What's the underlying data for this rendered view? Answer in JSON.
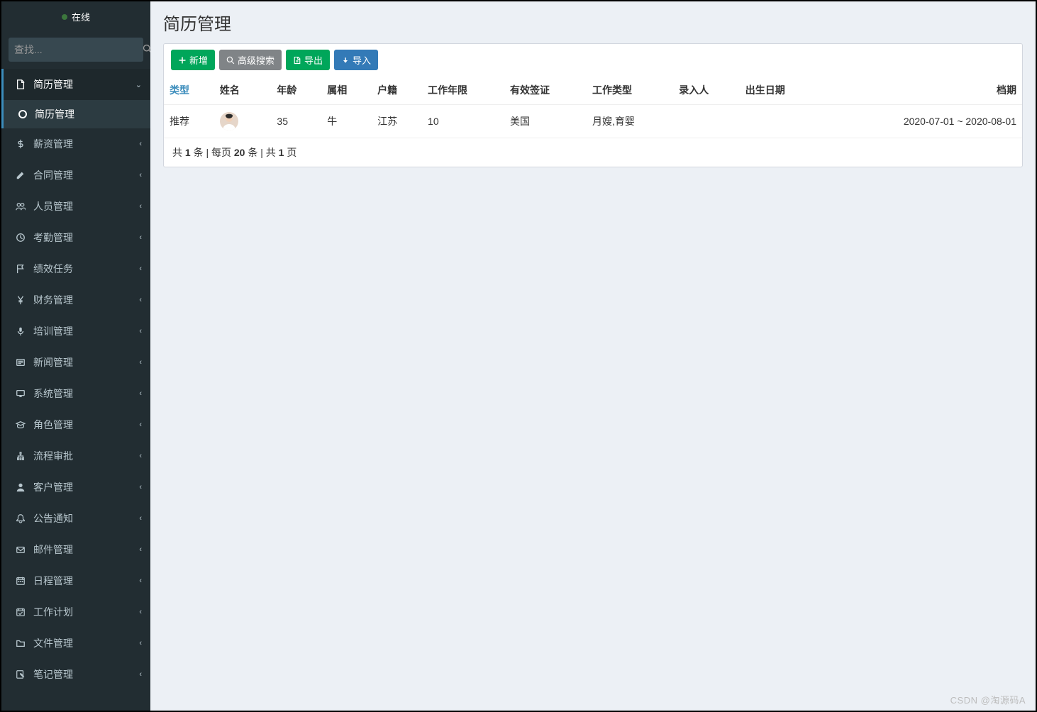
{
  "sidebar": {
    "status_label": "在线",
    "search_placeholder": "查找...",
    "items": [
      {
        "icon": "file",
        "label": "简历管理",
        "expanded": true,
        "active": true,
        "children": [
          {
            "label": "简历管理",
            "active": true
          }
        ]
      },
      {
        "icon": "dollar",
        "label": "薪资管理"
      },
      {
        "icon": "pencil",
        "label": "合同管理"
      },
      {
        "icon": "users",
        "label": "人员管理"
      },
      {
        "icon": "clock",
        "label": "考勤管理"
      },
      {
        "icon": "flag",
        "label": "绩效任务"
      },
      {
        "icon": "yen",
        "label": "财务管理"
      },
      {
        "icon": "mic",
        "label": "培训管理"
      },
      {
        "icon": "news",
        "label": "新闻管理"
      },
      {
        "icon": "desktop",
        "label": "系统管理"
      },
      {
        "icon": "cap",
        "label": "角色管理"
      },
      {
        "icon": "sitemap",
        "label": "流程审批"
      },
      {
        "icon": "user",
        "label": "客户管理"
      },
      {
        "icon": "bell",
        "label": "公告通知"
      },
      {
        "icon": "mail",
        "label": "邮件管理"
      },
      {
        "icon": "calendar",
        "label": "日程管理"
      },
      {
        "icon": "calcheck",
        "label": "工作计划"
      },
      {
        "icon": "folder",
        "label": "文件管理"
      },
      {
        "icon": "edit",
        "label": "笔记管理"
      }
    ]
  },
  "page": {
    "title": "简历管理"
  },
  "toolbar": {
    "add_label": "新增",
    "adv_search_label": "高级搜索",
    "export_label": "导出",
    "import_label": "导入"
  },
  "table": {
    "columns": [
      "类型",
      "姓名",
      "年龄",
      "属相",
      "户籍",
      "工作年限",
      "有效签证",
      "工作类型",
      "录入人",
      "出生日期",
      "档期"
    ],
    "sort_active_index": 0,
    "rows": [
      {
        "type": "推荐",
        "name": "",
        "has_avatar": true,
        "age": "35",
        "zodiac": "牛",
        "hukou": "江苏",
        "work_years": "10",
        "visa": "美国",
        "job_type": "月嫂,育婴",
        "entered_by": "",
        "birth_date": "",
        "period": "2020-07-01 ~ 2020-08-01"
      }
    ]
  },
  "pagination": {
    "text_pre_total": "共 ",
    "total": "1",
    "text_after_total": " 条 | 每页 ",
    "per_page": "20",
    "text_after_perpage": " 条 | 共 ",
    "pages": "1",
    "text_after_pages": " 页"
  },
  "watermark": "CSDN @淘源码A"
}
